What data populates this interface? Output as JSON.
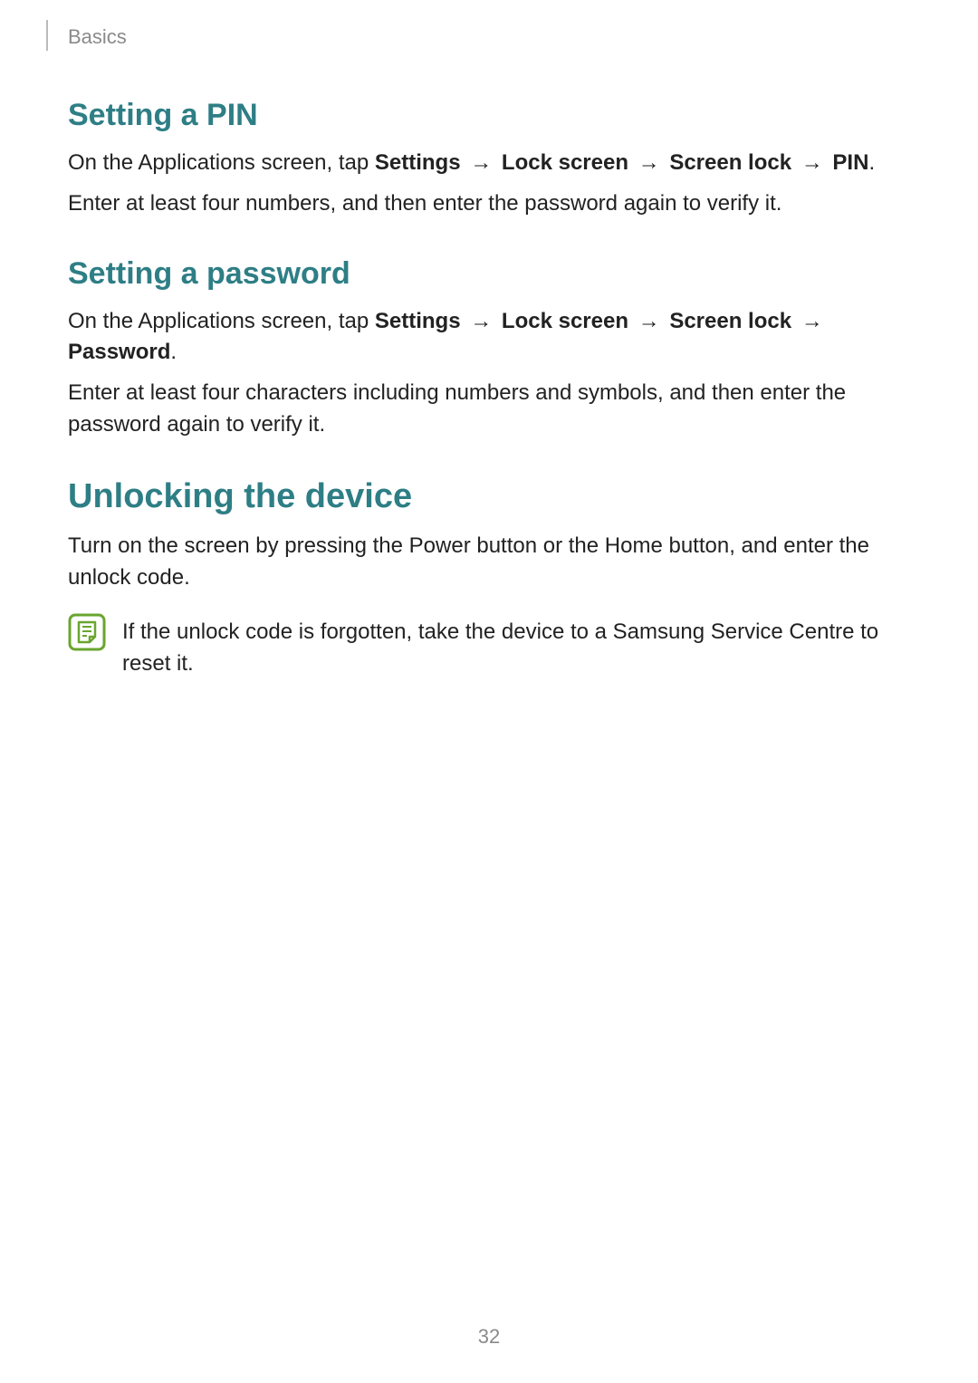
{
  "breadcrumb": "Basics",
  "sections": {
    "pin": {
      "title": "Setting a PIN",
      "intro": "On the Applications screen, tap ",
      "path": [
        "Settings",
        "Lock screen",
        "Screen lock",
        "PIN"
      ],
      "p2": "Enter at least four numbers, and then enter the password again to verify it."
    },
    "password": {
      "title": "Setting a password",
      "intro": "On the Applications screen, tap ",
      "path": [
        "Settings",
        "Lock screen",
        "Screen lock",
        "Password"
      ],
      "p2": "Enter at least four characters including numbers and symbols, and then enter the password again to verify it."
    },
    "unlock": {
      "title": "Unlocking the device",
      "p1": "Turn on the screen by pressing the Power button or the Home button, and enter the unlock code.",
      "note": "If the unlock code is forgotten, take the device to a Samsung Service Centre to reset it."
    }
  },
  "arrow": " → ",
  "period": ".",
  "page_number": "32"
}
